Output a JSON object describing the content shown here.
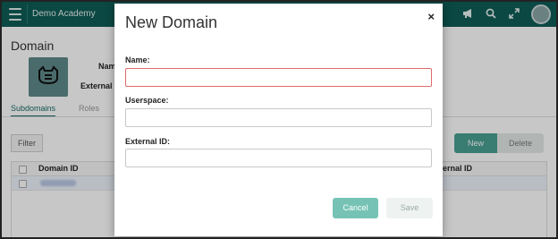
{
  "app": {
    "title": "Demo Academy",
    "icons": [
      "megaphone-icon",
      "search-icon",
      "expand-icon",
      "avatar"
    ]
  },
  "background": {
    "page_title": "Domain",
    "partial_labels": [
      "Nam",
      "External"
    ],
    "tabs": [
      {
        "label": "Subdomains",
        "active": true
      },
      {
        "label": "Roles",
        "active": false
      }
    ],
    "filter_label": "Filter",
    "new_label": "New",
    "delete_label": "Delete",
    "table": {
      "headers": [
        "Domain ID",
        "ernal ID"
      ]
    }
  },
  "modal": {
    "title": "New Domain",
    "close_glyph": "×",
    "fields": [
      {
        "label": "Name:",
        "value": "",
        "placeholder": "",
        "error": true
      },
      {
        "label": "Userspace:",
        "value": "",
        "placeholder": "",
        "error": false
      },
      {
        "label": "External ID:",
        "value": "",
        "placeholder": "",
        "error": false
      }
    ],
    "cancel_label": "Cancel",
    "save_label": "Save"
  },
  "colors": {
    "topbar": "#0f5d57",
    "accent": "#4a9f92",
    "cancel_button": "#76c3b6",
    "error_border": "#e06a6a"
  }
}
